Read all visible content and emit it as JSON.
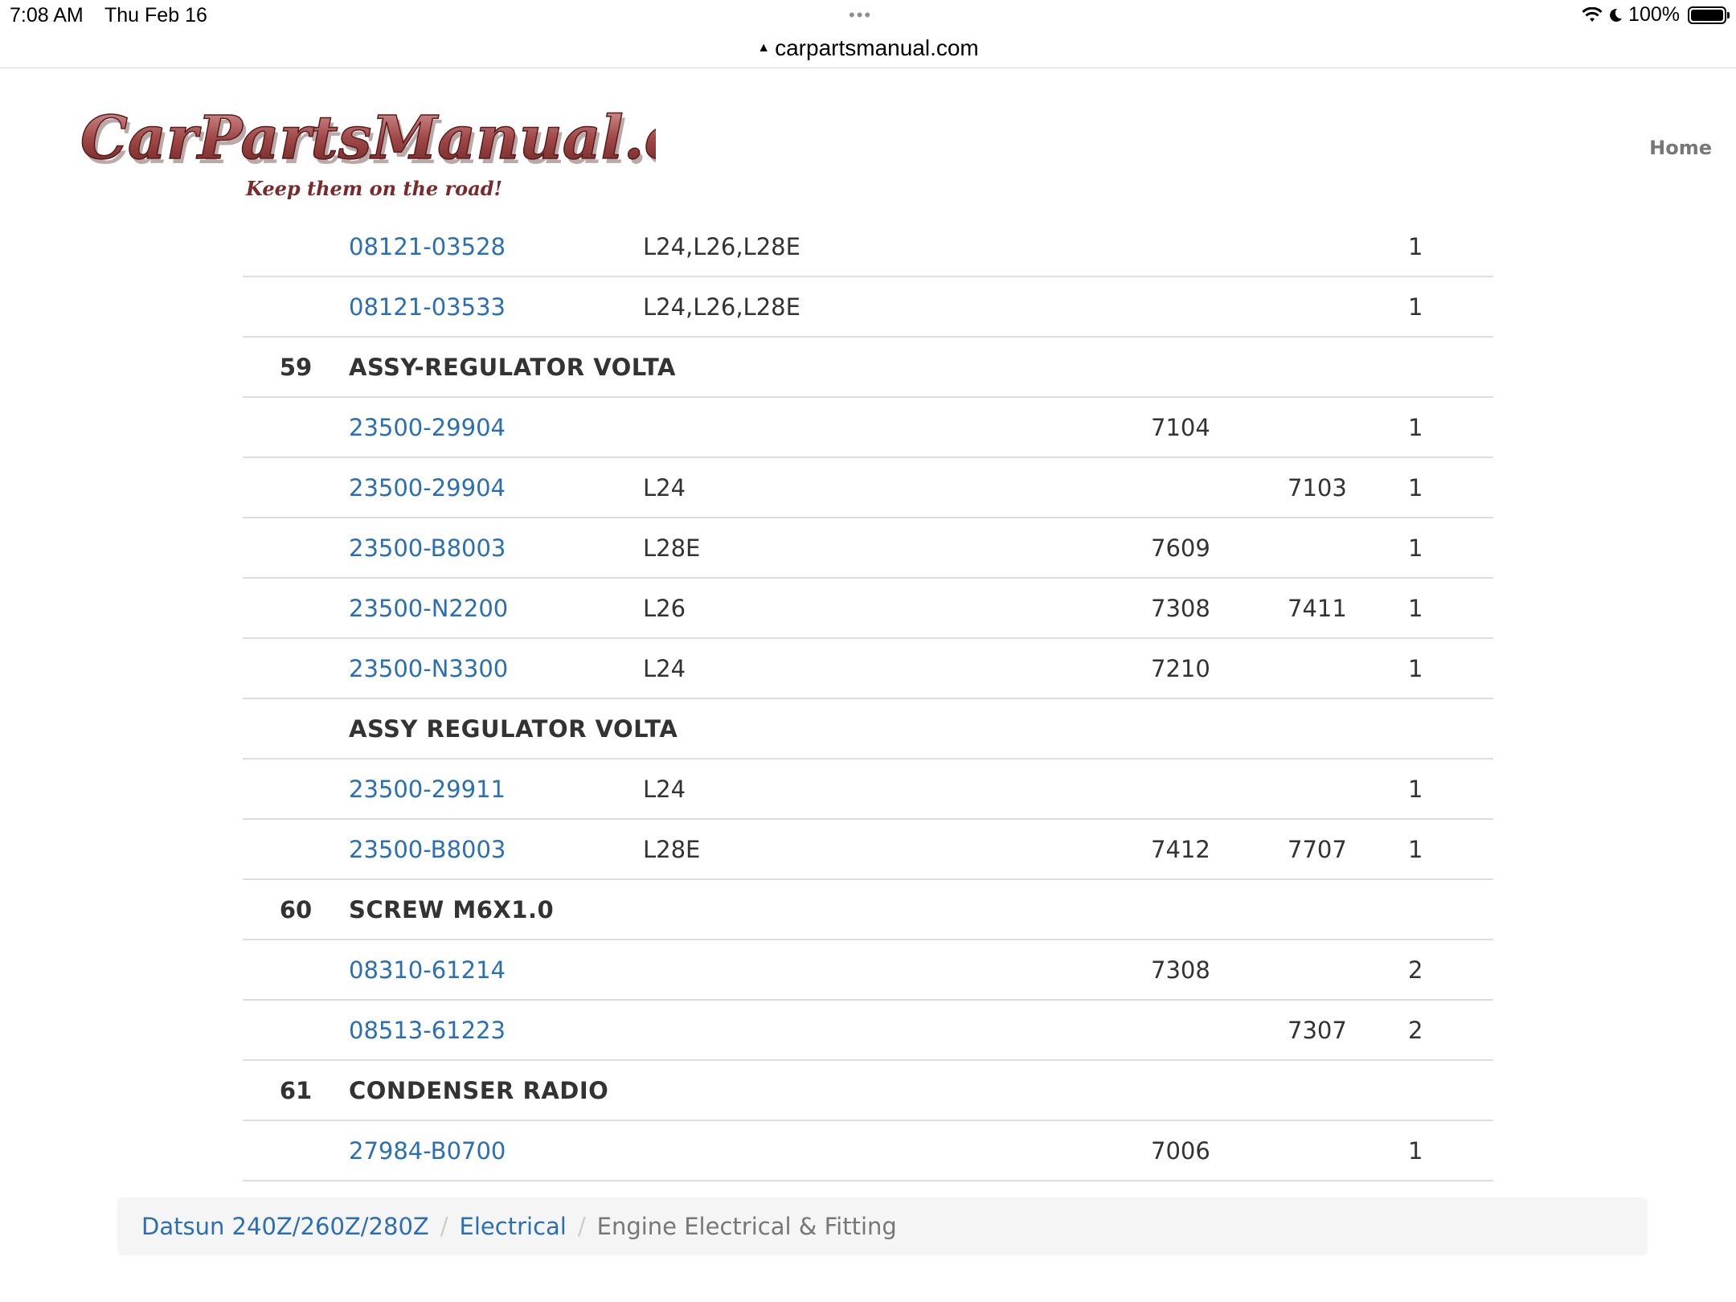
{
  "status_bar": {
    "time": "7:08 AM",
    "date": "Thu Feb 16",
    "dots": "•••",
    "battery": "100%"
  },
  "url_bar": {
    "lock_glyph": "▲",
    "url": "carpartsmanual.com"
  },
  "header": {
    "logo_text": "CarPartsManual.com",
    "logo_tagline": "Keep them on the road!",
    "nav_home": "Home"
  },
  "rows": [
    {
      "type": "part",
      "num": "",
      "part": "08121-03528",
      "engine": "L24,L26,L28E",
      "from": "",
      "to": "",
      "qty": "1"
    },
    {
      "type": "part",
      "num": "",
      "part": "08121-03533",
      "engine": "L24,L26,L28E",
      "from": "",
      "to": "",
      "qty": "1"
    },
    {
      "type": "group",
      "num": "59",
      "title": "ASSY-REGULATOR VOLTA"
    },
    {
      "type": "part",
      "num": "",
      "part": "23500-29904",
      "engine": "",
      "from": "7104",
      "to": "",
      "qty": "1"
    },
    {
      "type": "part",
      "num": "",
      "part": "23500-29904",
      "engine": "L24",
      "from": "",
      "to": "7103",
      "qty": "1"
    },
    {
      "type": "part",
      "num": "",
      "part": "23500-B8003",
      "engine": "L28E",
      "from": "7609",
      "to": "",
      "qty": "1"
    },
    {
      "type": "part",
      "num": "",
      "part": "23500-N2200",
      "engine": "L26",
      "from": "7308",
      "to": "7411",
      "qty": "1"
    },
    {
      "type": "part",
      "num": "",
      "part": "23500-N3300",
      "engine": "L24",
      "from": "7210",
      "to": "",
      "qty": "1"
    },
    {
      "type": "group",
      "num": "",
      "title": "ASSY REGULATOR VOLTA"
    },
    {
      "type": "part",
      "num": "",
      "part": "23500-29911",
      "engine": "L24",
      "from": "",
      "to": "",
      "qty": "1"
    },
    {
      "type": "part",
      "num": "",
      "part": "23500-B8003",
      "engine": "L28E",
      "from": "7412",
      "to": "7707",
      "qty": "1"
    },
    {
      "type": "group",
      "num": "60",
      "title": "SCREW M6X1.0"
    },
    {
      "type": "part",
      "num": "",
      "part": "08310-61214",
      "engine": "",
      "from": "7308",
      "to": "",
      "qty": "2"
    },
    {
      "type": "part",
      "num": "",
      "part": "08513-61223",
      "engine": "",
      "from": "",
      "to": "7307",
      "qty": "2"
    },
    {
      "type": "group",
      "num": "61",
      "title": "CONDENSER RADIO"
    },
    {
      "type": "part",
      "num": "",
      "part": "27984-B0700",
      "engine": "",
      "from": "7006",
      "to": "",
      "qty": "1"
    }
  ],
  "breadcrumb": {
    "items": [
      "Datsun 240Z/260Z/280Z",
      "Electrical"
    ],
    "current": "Engine Electrical & Fitting",
    "separator": "/"
  },
  "colors": {
    "link": "#2a6fb5",
    "logo": "#8b3a3a",
    "border": "#dddddd"
  }
}
